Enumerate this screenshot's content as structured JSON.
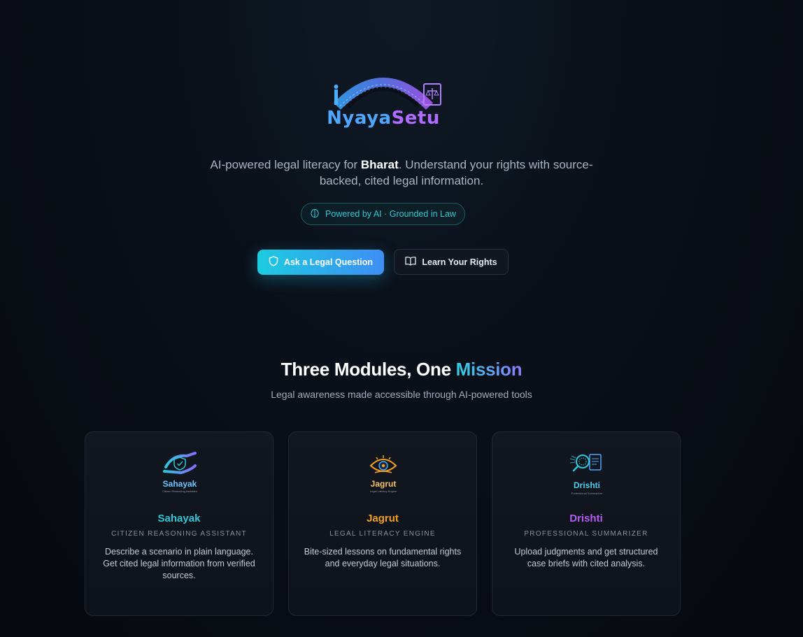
{
  "hero": {
    "logo_text_a": "Nyaya",
    "logo_text_b": "Setu",
    "tagline_pre": "AI-powered legal literacy for ",
    "tagline_bold": "Bharat",
    "tagline_post": ". Understand your rights with source-backed, cited legal information.",
    "pill_label": "Powered by AI · Grounded in Law",
    "primary_button": "Ask a Legal Question",
    "secondary_button": "Learn Your Rights"
  },
  "modules": {
    "title_pre": "Three Modules, One ",
    "title_accent": "Mission",
    "subtitle": "Legal awareness made accessible through AI-powered tools",
    "cards": [
      {
        "logo_text": "Sahayak",
        "logo_sub": "Citizen Reasoning Assistant",
        "name": "Sahayak",
        "kicker": "CITIZEN REASONING ASSISTANT",
        "description": "Describe a scenario in plain language. Get cited legal information from verified sources.",
        "color": "#2fc6d8"
      },
      {
        "logo_text": "Jagrut",
        "logo_sub": "Legal Literacy Engine",
        "name": "Jagrut",
        "kicker": "LEGAL LITERACY ENGINE",
        "description": "Bite-sized lessons on fundamental rights and everyday legal situations.",
        "color": "#f2a01e"
      },
      {
        "logo_text": "Drishti",
        "logo_sub": "Professional Summarizer",
        "name": "Drishti",
        "kicker": "PROFESSIONAL SUMMARIZER",
        "description": "Upload judgments and get structured case briefs with cited analysis.",
        "color": "#b45cf5"
      }
    ]
  },
  "icons": {
    "pill_icon": "brain-icon",
    "primary_button_icon": "shield-icon",
    "secondary_button_icon": "open-book-icon"
  }
}
